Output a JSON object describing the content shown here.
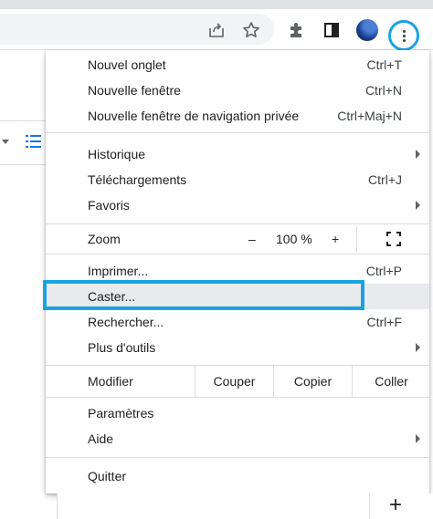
{
  "toolbar": {
    "icons": [
      "share-icon",
      "star-icon",
      "extensions-icon",
      "sidepanel-icon",
      "profile-avatar",
      "menu-dots-icon"
    ]
  },
  "menu": {
    "new_tab": {
      "label": "Nouvel onglet",
      "shortcut": "Ctrl+T"
    },
    "new_window": {
      "label": "Nouvelle fenêtre",
      "shortcut": "Ctrl+N"
    },
    "new_private": {
      "label": "Nouvelle fenêtre de navigation privée",
      "shortcut": "Ctrl+Maj+N"
    },
    "history": {
      "label": "Historique"
    },
    "downloads": {
      "label": "Téléchargements",
      "shortcut": "Ctrl+J"
    },
    "favorites": {
      "label": "Favoris"
    },
    "zoom": {
      "label": "Zoom",
      "minus": "–",
      "value": "100 %",
      "plus": "+"
    },
    "print": {
      "label": "Imprimer...",
      "shortcut": "Ctrl+P"
    },
    "cast": {
      "label": "Caster..."
    },
    "find": {
      "label": "Rechercher...",
      "shortcut": "Ctrl+F"
    },
    "more_tools": {
      "label": "Plus d'outils"
    },
    "edit": {
      "label": "Modifier",
      "cut": "Couper",
      "copy": "Copier",
      "paste": "Coller"
    },
    "settings": {
      "label": "Paramètres"
    },
    "help": {
      "label": "Aide"
    },
    "quit": {
      "label": "Quitter"
    }
  },
  "page": {
    "plus": "+"
  },
  "colors": {
    "highlight": "#1aa3e0",
    "hover_row": "#e8eaed"
  }
}
